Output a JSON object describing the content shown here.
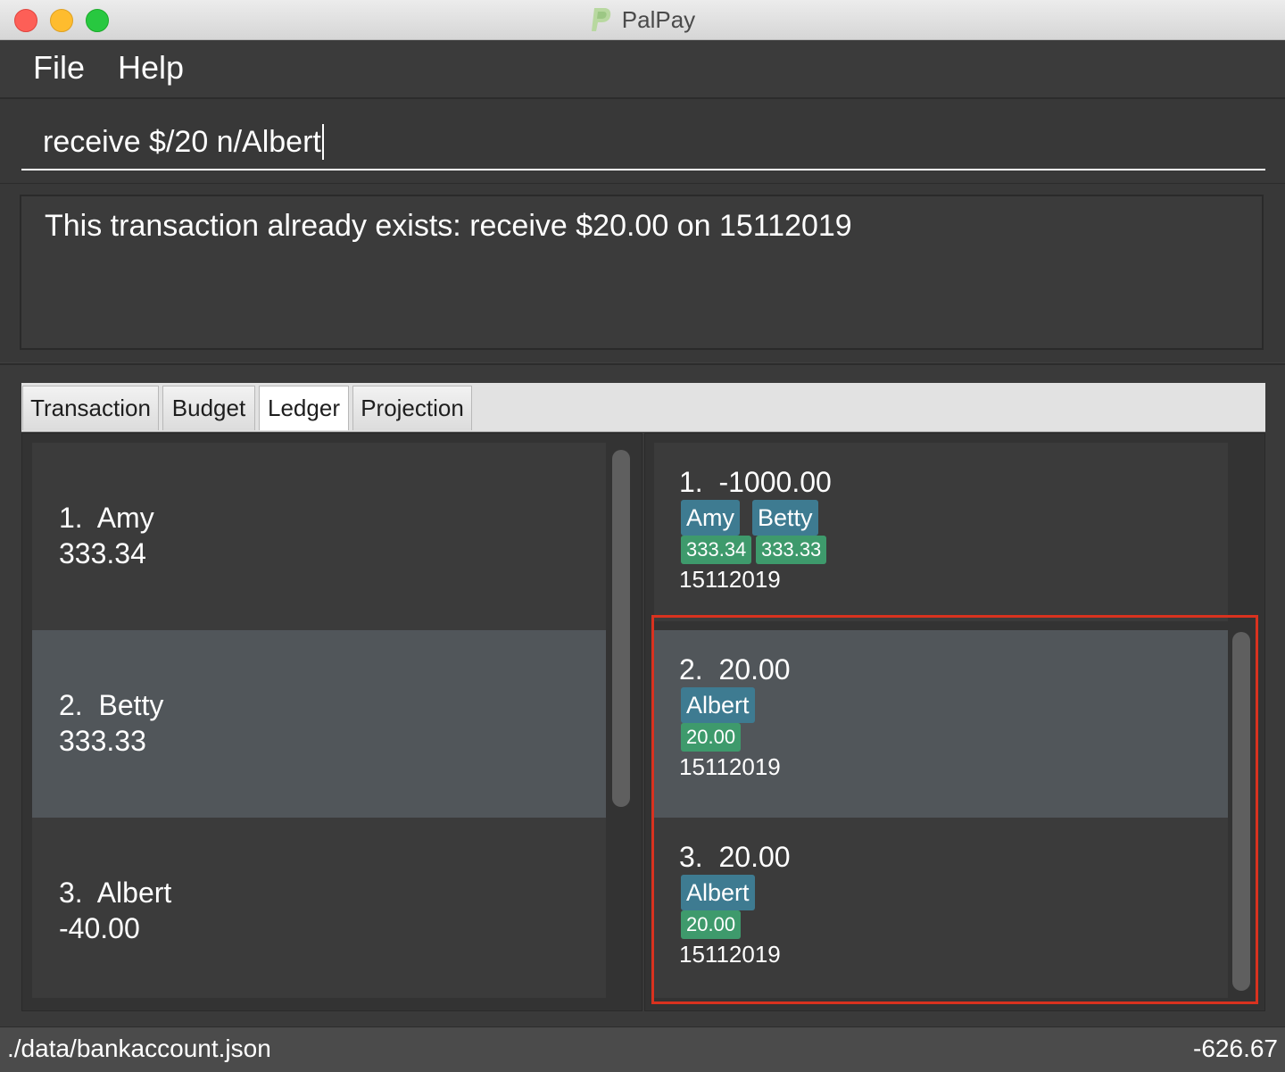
{
  "window": {
    "title": "PalPay"
  },
  "menu": {
    "items": [
      "File",
      "Help"
    ]
  },
  "command": {
    "value": "receive $/20 n/Albert"
  },
  "result": {
    "message": "This transaction already exists: receive $20.00 on 15112019"
  },
  "tabs": [
    "Transaction",
    "Budget",
    "Ledger",
    "Projection"
  ],
  "active_tab": "Ledger",
  "people": [
    {
      "index": "1.",
      "name": "Amy",
      "amount": "333.34"
    },
    {
      "index": "2.",
      "name": "Betty",
      "amount": "333.33"
    },
    {
      "index": "3.",
      "name": "Albert",
      "amount": "-40.00"
    }
  ],
  "ledger_transactions": [
    {
      "index": "1.",
      "amount": "-1000.00",
      "names": [
        "Amy",
        "Betty"
      ],
      "splits": [
        "333.34",
        "333.33"
      ],
      "date": "15112019"
    },
    {
      "index": "2.",
      "amount": "20.00",
      "names": [
        "Albert"
      ],
      "splits": [
        "20.00"
      ],
      "date": "15112019"
    },
    {
      "index": "3.",
      "amount": "20.00",
      "names": [
        "Albert"
      ],
      "splits": [
        "20.00"
      ],
      "date": "15112019"
    }
  ],
  "status": {
    "file_path": "./data/bankaccount.json",
    "balance": "-626.67"
  },
  "colors": {
    "highlight": "#d9321f",
    "name_tag": "#3e7b91",
    "amount_tag": "#3e9a6c"
  }
}
